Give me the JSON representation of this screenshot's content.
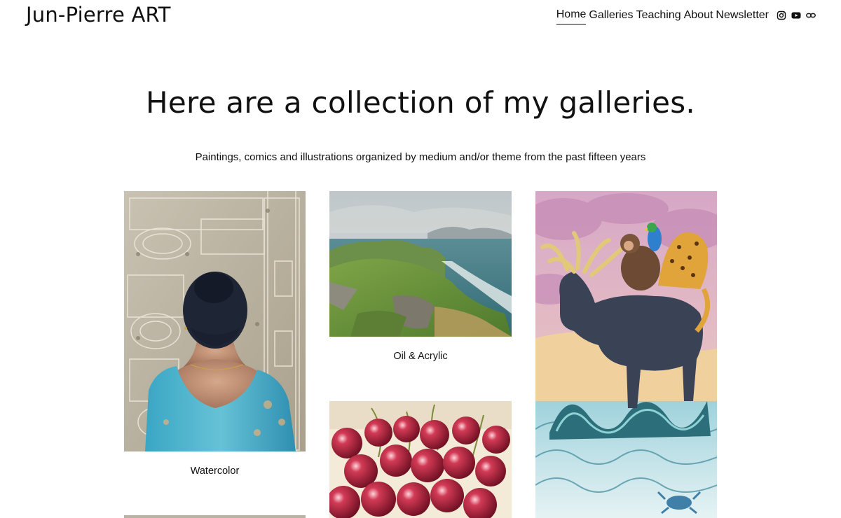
{
  "header": {
    "site_title": "Jun-Pierre ART",
    "nav": [
      "Home",
      "Galleries",
      "Teaching",
      "About",
      "Newsletter"
    ],
    "active": "Home",
    "social_icons": [
      "instagram-icon",
      "youtube-icon",
      "link-icon"
    ]
  },
  "hero": {
    "title": "Here are a collection of my galleries.",
    "subtitle": "Paintings, comics and illustrations organized by medium and/or theme from the past fifteen years"
  },
  "galleries": [
    {
      "caption": "Watercolor",
      "image": "woman-in-blue-dress-before-ornate-door"
    },
    {
      "caption": "Oil & Acrylic",
      "image": "coastal-cliff-landscape"
    },
    {
      "caption": "",
      "image": "cherries-watercolor"
    },
    {
      "caption": "",
      "image": "moose-monkey-parrot-jaguar-on-wave"
    }
  ],
  "colors": {
    "text": "#111111",
    "background": "#ffffff"
  }
}
